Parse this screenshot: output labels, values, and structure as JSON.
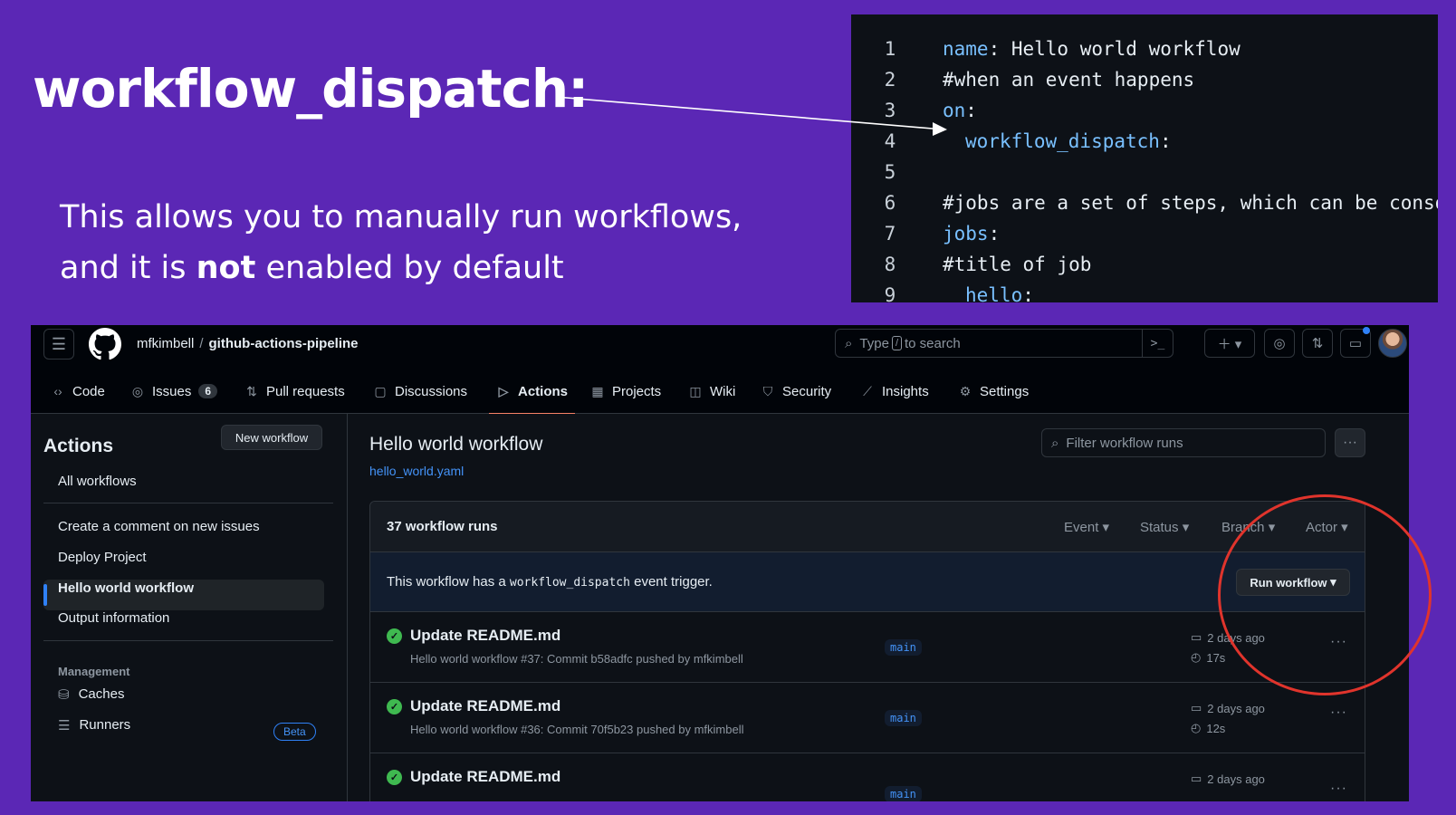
{
  "slide": {
    "title": "workflow_dispatch:",
    "desc_part1": "This allows you to manually run workflows, and it is ",
    "desc_bold": "not",
    "desc_part2": " enabled by default"
  },
  "code": {
    "lines": [
      {
        "n": "1",
        "key": "name",
        "rest": ": Hello world workflow"
      },
      {
        "n": "2",
        "comment": "#when an event happens"
      },
      {
        "n": "3",
        "key": "on",
        "rest": ":"
      },
      {
        "n": "4",
        "indent": "  ",
        "key": "workflow_dispatch",
        "rest": ":"
      },
      {
        "n": "5"
      },
      {
        "n": "6",
        "comment": "#jobs are a set of steps, which can be conso"
      },
      {
        "n": "7",
        "key": "jobs",
        "rest": ":"
      },
      {
        "n": "8",
        "comment": "#title of job"
      },
      {
        "n": "9",
        "indent": "  ",
        "key": "hello",
        "rest": ":"
      }
    ]
  },
  "github": {
    "owner": "mfkimbell",
    "repo": "github-actions-pipeline",
    "search_prefix": "Type",
    "search_key": "/",
    "search_suffix": "to search",
    "tabs": [
      {
        "label": "Code",
        "icon": "code-icon"
      },
      {
        "label": "Issues",
        "icon": "issue-icon",
        "count": "6"
      },
      {
        "label": "Pull requests",
        "icon": "pull-request-icon"
      },
      {
        "label": "Discussions",
        "icon": "discussion-icon"
      },
      {
        "label": "Actions",
        "icon": "play-icon"
      },
      {
        "label": "Projects",
        "icon": "table-icon"
      },
      {
        "label": "Wiki",
        "icon": "book-icon"
      },
      {
        "label": "Security",
        "icon": "shield-icon"
      },
      {
        "label": "Insights",
        "icon": "graph-icon"
      },
      {
        "label": "Settings",
        "icon": "gear-icon"
      }
    ],
    "sidebar": {
      "title": "Actions",
      "new_workflow": "New workflow",
      "all_workflows": "All workflows",
      "items": [
        "Create a comment on new issues",
        "Deploy Project",
        "Hello world workflow",
        "Output information"
      ],
      "management_head": "Management",
      "caches": "Caches",
      "runners": "Runners",
      "beta": "Beta"
    },
    "main": {
      "title": "Hello world workflow",
      "file": "hello_world.yaml",
      "filter_placeholder": "Filter workflow runs",
      "runs_count": "37 workflow runs",
      "filters": [
        "Event",
        "Status",
        "Branch",
        "Actor"
      ],
      "dispatch_prefix": "This workflow has a",
      "dispatch_code": "workflow_dispatch",
      "dispatch_suffix": "event trigger.",
      "run_workflow": "Run workflow",
      "runs": [
        {
          "title": "Update README.md",
          "sub": "Hello world workflow #37: Commit b58adfc pushed by mfkimbell",
          "branch": "main",
          "when": "2 days ago",
          "duration": "17s"
        },
        {
          "title": "Update README.md",
          "sub": "Hello world workflow #36: Commit 70f5b23 pushed by mfkimbell",
          "branch": "main",
          "when": "2 days ago",
          "duration": "12s"
        },
        {
          "title": "Update README.md",
          "sub": "",
          "branch": "main",
          "when": "2 days ago",
          "duration": ""
        }
      ]
    }
  },
  "colors": {
    "background": "#5b27b5",
    "accent_tab": "#f78166",
    "link": "#4493f8",
    "success": "#3fb950",
    "highlight_circle": "#e0342c"
  }
}
